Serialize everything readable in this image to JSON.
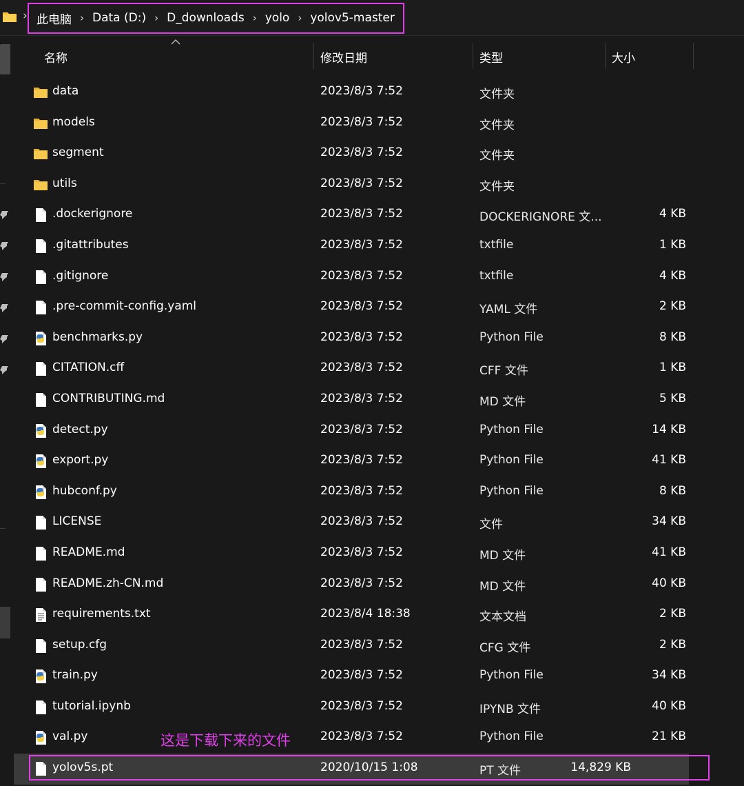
{
  "address_bar": {
    "crumbs": [
      "此电脑",
      "Data (D:)",
      "D_downloads",
      "yolo",
      "yolov5-master"
    ],
    "separator": "›"
  },
  "columns": {
    "name": "名称",
    "date": "修改日期",
    "type": "类型",
    "size": "大小"
  },
  "files": [
    {
      "name": "data",
      "date": "2023/8/3 7:52",
      "type": "文件夹",
      "size": "",
      "icon": "folder-icon"
    },
    {
      "name": "models",
      "date": "2023/8/3 7:52",
      "type": "文件夹",
      "size": "",
      "icon": "folder-icon"
    },
    {
      "name": "segment",
      "date": "2023/8/3 7:52",
      "type": "文件夹",
      "size": "",
      "icon": "folder-icon"
    },
    {
      "name": "utils",
      "date": "2023/8/3 7:52",
      "type": "文件夹",
      "size": "",
      "icon": "folder-icon"
    },
    {
      "name": ".dockerignore",
      "date": "2023/8/3 7:52",
      "type": "DOCKERIGNORE 文...",
      "size": "4 KB",
      "icon": "file-icon"
    },
    {
      "name": ".gitattributes",
      "date": "2023/8/3 7:52",
      "type": "txtfile",
      "size": "1 KB",
      "icon": "file-icon"
    },
    {
      "name": ".gitignore",
      "date": "2023/8/3 7:52",
      "type": "txtfile",
      "size": "4 KB",
      "icon": "file-icon"
    },
    {
      "name": ".pre-commit-config.yaml",
      "date": "2023/8/3 7:52",
      "type": "YAML 文件",
      "size": "2 KB",
      "icon": "file-icon"
    },
    {
      "name": "benchmarks.py",
      "date": "2023/8/3 7:52",
      "type": "Python File",
      "size": "8 KB",
      "icon": "python-file-icon"
    },
    {
      "name": "CITATION.cff",
      "date": "2023/8/3 7:52",
      "type": "CFF 文件",
      "size": "1 KB",
      "icon": "file-icon"
    },
    {
      "name": "CONTRIBUTING.md",
      "date": "2023/8/3 7:52",
      "type": "MD 文件",
      "size": "5 KB",
      "icon": "file-icon"
    },
    {
      "name": "detect.py",
      "date": "2023/8/3 7:52",
      "type": "Python File",
      "size": "14 KB",
      "icon": "python-file-icon"
    },
    {
      "name": "export.py",
      "date": "2023/8/3 7:52",
      "type": "Python File",
      "size": "41 KB",
      "icon": "python-file-icon"
    },
    {
      "name": "hubconf.py",
      "date": "2023/8/3 7:52",
      "type": "Python File",
      "size": "8 KB",
      "icon": "python-file-icon"
    },
    {
      "name": "LICENSE",
      "date": "2023/8/3 7:52",
      "type": "文件",
      "size": "34 KB",
      "icon": "file-icon"
    },
    {
      "name": "README.md",
      "date": "2023/8/3 7:52",
      "type": "MD 文件",
      "size": "41 KB",
      "icon": "file-icon"
    },
    {
      "name": "README.zh-CN.md",
      "date": "2023/8/3 7:52",
      "type": "MD 文件",
      "size": "40 KB",
      "icon": "file-icon"
    },
    {
      "name": "requirements.txt",
      "date": "2023/8/4 18:38",
      "type": "文本文档",
      "size": "2 KB",
      "icon": "text-file-icon"
    },
    {
      "name": "setup.cfg",
      "date": "2023/8/3 7:52",
      "type": "CFG 文件",
      "size": "2 KB",
      "icon": "file-icon"
    },
    {
      "name": "train.py",
      "date": "2023/8/3 7:52",
      "type": "Python File",
      "size": "34 KB",
      "icon": "python-file-icon"
    },
    {
      "name": "tutorial.ipynb",
      "date": "2023/8/3 7:52",
      "type": "IPYNB 文件",
      "size": "40 KB",
      "icon": "file-icon"
    },
    {
      "name": "val.py",
      "date": "2023/8/3 7:52",
      "type": "Python File",
      "size": "21 KB",
      "icon": "python-file-icon"
    },
    {
      "name": "yolov5s.pt",
      "date": "2020/10/15 1:08",
      "type": "PT 文件",
      "size": "14,829 KB",
      "icon": "file-icon",
      "selected": true
    }
  ],
  "annotation": "这是下载下来的文件",
  "colors": {
    "background": "#191919",
    "highlight": "#e040e8",
    "selected_row": "#3b3b3b",
    "folder": "#f3c23f",
    "python_blue": "#3b78c4",
    "python_yellow": "#f3d046"
  }
}
